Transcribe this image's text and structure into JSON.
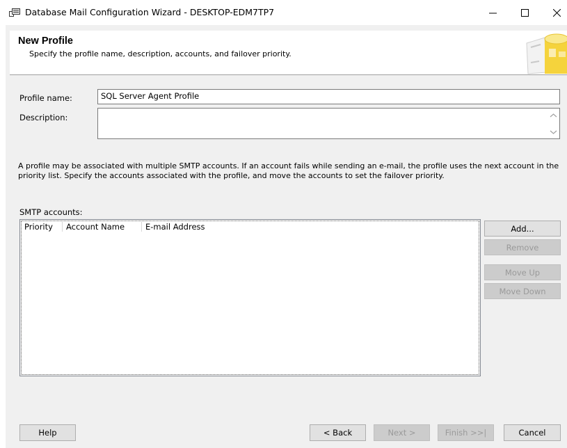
{
  "window": {
    "title": "Database Mail Configuration Wizard - DESKTOP-EDM7TP7"
  },
  "header": {
    "title": "New Profile",
    "subtitle": "Specify the profile name, description, accounts, and failover priority."
  },
  "form": {
    "profile_name_label": "Profile name:",
    "profile_name_value": "SQL Server Agent Profile",
    "description_label": "Description:",
    "description_value": ""
  },
  "info_text": "A profile may be associated with multiple SMTP accounts. If an account fails while sending an e-mail, the profile uses the next account in the priority list. Specify the accounts associated with the profile, and move the accounts to set the failover priority.",
  "smtp": {
    "label": "SMTP accounts:",
    "columns": [
      "Priority",
      "Account Name",
      "E-mail Address"
    ],
    "rows": []
  },
  "side_buttons": {
    "add": "Add...",
    "remove": "Remove",
    "move_up": "Move Up",
    "move_down": "Move Down"
  },
  "footer": {
    "help": "Help",
    "back": "< Back",
    "next": "Next >",
    "finish": "Finish >>|",
    "cancel": "Cancel"
  },
  "colors": {
    "dialog_bg": "#f0f0f0",
    "button_bg": "#e1e1e1",
    "disabled_text": "#9a9a9a",
    "header_graphic_yellow": "#f5d33c"
  }
}
